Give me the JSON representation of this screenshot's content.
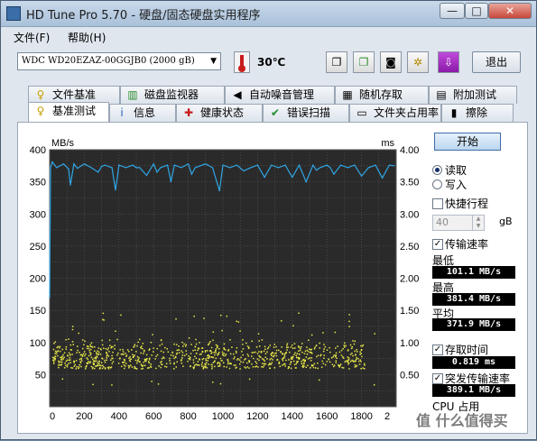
{
  "window": {
    "title": "HD Tune Pro 5.70 - 硬盘/固态硬盘实用程序",
    "min_glyph": "—",
    "max_glyph": "□",
    "close_glyph": "✕"
  },
  "menu": {
    "file": "文件(F)",
    "help": "帮助(H)"
  },
  "toolbar": {
    "drive": "WDC WD20EZAZ-00GGJB0 (2000 gB)",
    "temperature": "30℃",
    "exit_label": "退出"
  },
  "tabs_top": [
    {
      "label": "文件基准",
      "icon": "file-benchmark-icon",
      "glyph": "♀"
    },
    {
      "label": "磁盘监视器",
      "icon": "disk-monitor-icon",
      "glyph": "▥"
    },
    {
      "label": "自动噪音管理",
      "icon": "speaker-icon",
      "glyph": "◀"
    },
    {
      "label": "随机存取",
      "icon": "random-access-icon",
      "glyph": "▦"
    },
    {
      "label": "附加测试",
      "icon": "extra-tests-icon",
      "glyph": "▤"
    }
  ],
  "tabs_bottom": [
    {
      "label": "基准测试",
      "icon": "benchmark-icon",
      "glyph": "♀"
    },
    {
      "label": "信息",
      "icon": "info-icon",
      "glyph": "i"
    },
    {
      "label": "健康状态",
      "icon": "health-icon",
      "glyph": "✚"
    },
    {
      "label": "错误扫描",
      "icon": "error-scan-icon",
      "glyph": "✔"
    },
    {
      "label": "文件夹占用率",
      "icon": "folder-usage-icon",
      "glyph": "▭"
    },
    {
      "label": "擦除",
      "icon": "erase-icon",
      "glyph": "▮"
    }
  ],
  "side": {
    "start_label": "开始",
    "read_label": "读取",
    "write_label": "写入",
    "quick_label": "快捷行程",
    "quick_value": "40",
    "quick_unit": "gB",
    "transfer_label": "传输速率",
    "min_label": "最低",
    "min_value": "101.1 MB/s",
    "max_label": "最高",
    "max_value": "381.4 MB/s",
    "avg_label": "平均",
    "avg_value": "371.9 MB/s",
    "access_label": "存取时间",
    "access_value": "0.819 ms",
    "burst_label": "突发传输速率",
    "burst_value": "389.1 MB/s",
    "cpu_label": "CPU 占用"
  },
  "watermark": "值 什么值得买",
  "chart_data": {
    "type": "line",
    "left_unit": "MB/s",
    "right_unit": "ms",
    "y_ticks": [
      "400",
      "350",
      "300",
      "250",
      "200",
      "150",
      "100",
      "50"
    ],
    "right_ticks": [
      "4.00",
      "3.50",
      "3.00",
      "2.50",
      "2.00",
      "1.50",
      "1.00",
      "0.50"
    ],
    "x_ticks": [
      "0",
      "200",
      "400",
      "600",
      "800",
      "1000",
      "1200",
      "1400",
      "1600",
      "1800",
      "2"
    ],
    "ylim": [
      0,
      400
    ],
    "y2lim": [
      0,
      4
    ],
    "xlim": [
      0,
      2000
    ],
    "grid": true,
    "series": [
      {
        "color": "#2fa6e6",
        "x": [
          0,
          5,
          15,
          40,
          80,
          110,
          120,
          140,
          160,
          200,
          240,
          280,
          300,
          320,
          360,
          380,
          400,
          440,
          480,
          500,
          520,
          560,
          600,
          620,
          640,
          680,
          700,
          720,
          760,
          800,
          820,
          840,
          880,
          900,
          940,
          980,
          1000,
          1040,
          1080,
          1120,
          1160,
          1200,
          1240,
          1280,
          1320,
          1360,
          1400,
          1440,
          1480,
          1520,
          1540,
          1560,
          1600,
          1620,
          1640,
          1680,
          1720,
          1760,
          1800,
          1840,
          1880,
          1920,
          1960,
          1990
        ],
        "y": [
          170,
          372,
          381,
          372,
          378,
          370,
          345,
          378,
          371,
          378,
          372,
          365,
          374,
          376,
          372,
          337,
          376,
          372,
          376,
          372,
          372,
          360,
          378,
          365,
          372,
          376,
          350,
          376,
          372,
          378,
          362,
          372,
          376,
          378,
          372,
          336,
          376,
          372,
          376,
          367,
          372,
          376,
          357,
          376,
          372,
          376,
          357,
          376,
          350,
          376,
          368,
          372,
          376,
          372,
          362,
          376,
          372,
          376,
          359,
          372,
          376,
          356,
          376,
          375
        ]
      }
    ],
    "access_points": {
      "color": "#e8e84a",
      "band_ms": [
        0.6,
        1.1
      ],
      "outliers_ms": [
        1.2,
        1.4,
        0.4
      ]
    }
  }
}
